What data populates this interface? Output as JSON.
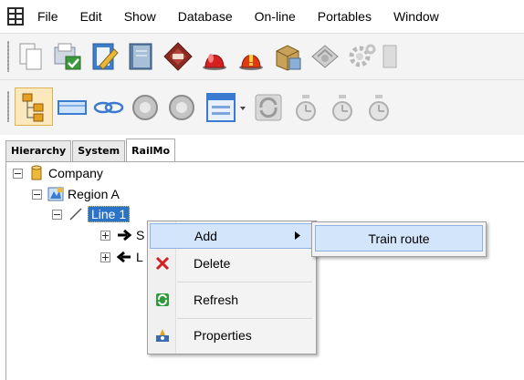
{
  "menubar": {
    "items": [
      "File",
      "Edit",
      "Show",
      "Database",
      "On-line",
      "Portables",
      "Window"
    ]
  },
  "toolbar1": {
    "buttons": [
      "copy-icon",
      "properties-check-icon",
      "edit-document-icon",
      "book-icon",
      "diamond-icon",
      "alarm-red-icon",
      "alarm-orange-icon",
      "package-icon",
      "map-icon",
      "gear-icon"
    ]
  },
  "toolbar2": {
    "buttons": [
      "hierarchy-icon",
      "rectangle-icon",
      "link-icon",
      "back-circle-icon",
      "forward-circle-icon",
      "form-window-icon",
      "refresh-icon",
      "clock-icon",
      "clock-icon",
      "clock-icon"
    ]
  },
  "tabs": {
    "items": [
      "Hierarchy",
      "System",
      "RailMo"
    ],
    "active": "RailMo"
  },
  "tree": {
    "company": "Company",
    "region": "Region A",
    "line": "Line 1",
    "child1": "S",
    "child2": "L"
  },
  "context_menu": {
    "items": [
      {
        "label": "Add",
        "icon": "none",
        "has_submenu": true
      },
      {
        "label": "Delete",
        "icon": "red-x-icon"
      },
      {
        "label": "Refresh",
        "icon": "green-refresh-icon"
      },
      {
        "label": "Properties",
        "icon": "properties-icon"
      }
    ],
    "submenu": {
      "label": "Train route"
    }
  },
  "colors": {
    "selection": "#2b72c9",
    "menu_hover": "#d3e5fb",
    "menu_hover_border": "#8db2e3"
  }
}
